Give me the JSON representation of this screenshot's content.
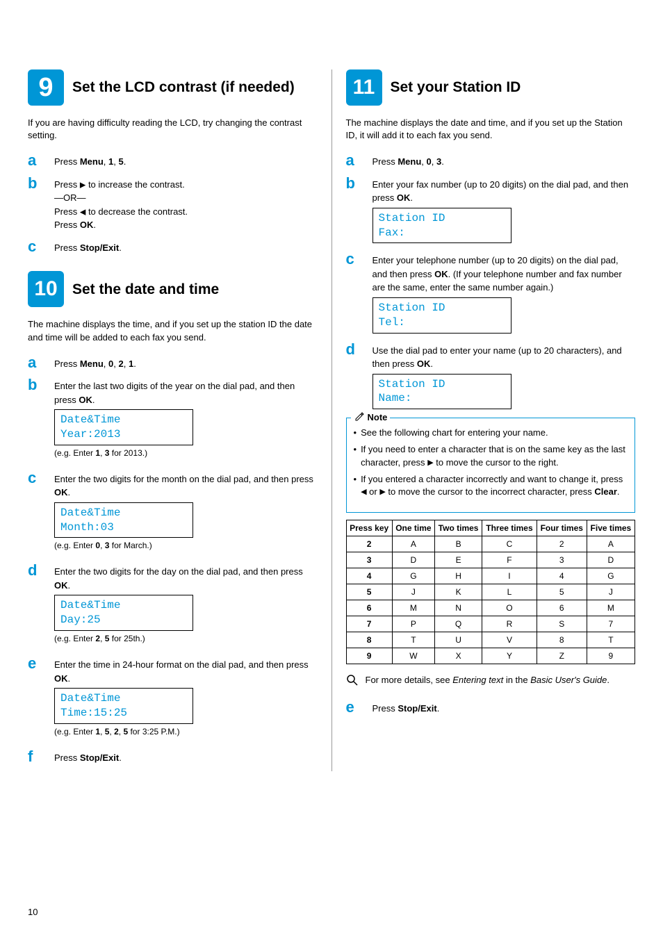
{
  "step9": {
    "num": "9",
    "title": "Set the LCD contrast (if needed)",
    "intro": "If you are having difficulty reading the LCD, try changing the contrast setting.",
    "a": {
      "pre": "Press ",
      "bold": "Menu",
      "sep1": ", ",
      "b1": "1",
      "sep2": ", ",
      "b2": "5",
      "end": "."
    },
    "b": {
      "l1": "Press",
      "l1b": " to increase the contrast.",
      "or": "—OR—",
      "l2": "Press",
      "l2b": " to decrease the contrast.",
      "l3a": "Press ",
      "l3b": "OK",
      "l3c": "."
    },
    "c": {
      "pre": "Press ",
      "bold": "Stop/Exit",
      "end": "."
    }
  },
  "step10": {
    "num": "10",
    "title": "Set the date and time",
    "intro": "The machine displays the time, and if you set up the station ID the date and time will be added to each fax you send.",
    "a": {
      "pre": "Press ",
      "bold": "Menu",
      "s1": ", ",
      "b1": "0",
      "s2": ", ",
      "b2": "2",
      "s3": ", ",
      "b3": "1",
      "end": "."
    },
    "b": {
      "txt1": "Enter the last two digits of the year on the dial pad, and then press ",
      "bold": "OK",
      "end": ".",
      "lcd1": "Date&Time",
      "lcd2": "Year:2013",
      "eg_pre": "(e.g. Enter ",
      "eg_b1": "1",
      "eg_s": ", ",
      "eg_b2": "3",
      "eg_end": " for 2013.)"
    },
    "c": {
      "txt1": "Enter the two digits for the month on the dial pad, and then press ",
      "bold": "OK",
      "end": ".",
      "lcd1": "Date&Time",
      "lcd2": "Month:03",
      "eg_pre": "(e.g. Enter ",
      "eg_b1": "0",
      "eg_s": ", ",
      "eg_b2": "3",
      "eg_end": " for March.)"
    },
    "d": {
      "txt1": "Enter the two digits for the day on the dial pad, and then press ",
      "bold": "OK",
      "end": ".",
      "lcd1": "Date&Time",
      "lcd2": "Day:25",
      "eg_pre": "(e.g. Enter ",
      "eg_b1": "2",
      "eg_s": ", ",
      "eg_b2": "5",
      "eg_end": " for 25th.)"
    },
    "e": {
      "txt1": "Enter the time in 24-hour format on the dial pad, and then press ",
      "bold": "OK",
      "end": ".",
      "lcd1": "Date&Time",
      "lcd2": "Time:15:25",
      "eg_pre": "(e.g. Enter ",
      "eg_b1": "1",
      "eg_s1": ", ",
      "eg_b2": "5",
      "eg_s2": ", ",
      "eg_b3": "2",
      "eg_s3": ", ",
      "eg_b4": "5",
      "eg_end": " for 3:25 P.M.)"
    },
    "f": {
      "pre": "Press ",
      "bold": "Stop/Exit",
      "end": "."
    }
  },
  "step11": {
    "num": "11",
    "title": "Set your Station ID",
    "intro": "The machine displays the date and time, and if you set up the Station ID, it will add it to each fax you send.",
    "a": {
      "pre": "Press ",
      "bold": "Menu",
      "s1": ", ",
      "b1": "0",
      "s2": ", ",
      "b2": "3",
      "end": "."
    },
    "b": {
      "txt1": "Enter your fax number (up to 20 digits) on the dial pad, and then press ",
      "bold": "OK",
      "end": ".",
      "lcd1": "Station ID",
      "lcd2": "Fax:"
    },
    "c": {
      "txt1": "Enter your telephone number (up to 20 digits) on the dial pad, and then press ",
      "bold": "OK",
      "end": ". (If your telephone number and fax number are the same, enter the same number again.)",
      "lcd1": "Station ID",
      "lcd2": "Tel:"
    },
    "d": {
      "txt1": "Use the dial pad to enter your name (up to 20 characters), and then press ",
      "bold": "OK",
      "end": ".",
      "lcd1": "Station ID",
      "lcd2": "Name:"
    },
    "note": {
      "title": "Note",
      "li1": "See the following chart for entering your name.",
      "li2a": "If you need to enter a character that is on the same key as the last character, press",
      "li2b": " to move the cursor to the right.",
      "li3a": "If you entered a character incorrectly and want to change it, press",
      "li3mid": " or",
      "li3b": " to move the cursor to the incorrect character, press ",
      "li3bold": "Clear",
      "li3end": "."
    },
    "table": {
      "h1": "Press key",
      "h2": "One time",
      "h3": "Two times",
      "h4": "Three times",
      "h5": "Four times",
      "h6": "Five times",
      "rows": [
        {
          "k": "2",
          "c": [
            "A",
            "B",
            "C",
            "2",
            "A"
          ]
        },
        {
          "k": "3",
          "c": [
            "D",
            "E",
            "F",
            "3",
            "D"
          ]
        },
        {
          "k": "4",
          "c": [
            "G",
            "H",
            "I",
            "4",
            "G"
          ]
        },
        {
          "k": "5",
          "c": [
            "J",
            "K",
            "L",
            "5",
            "J"
          ]
        },
        {
          "k": "6",
          "c": [
            "M",
            "N",
            "O",
            "6",
            "M"
          ]
        },
        {
          "k": "7",
          "c": [
            "P",
            "Q",
            "R",
            "S",
            "7"
          ]
        },
        {
          "k": "8",
          "c": [
            "T",
            "U",
            "V",
            "8",
            "T"
          ]
        },
        {
          "k": "9",
          "c": [
            "W",
            "X",
            "Y",
            "Z",
            "9"
          ]
        }
      ]
    },
    "hint": {
      "pre": "For more details, see ",
      "em": "Entering text",
      "mid": " in the ",
      "em2": "Basic User's Guide",
      "end": "."
    },
    "e": {
      "pre": "Press ",
      "bold": "Stop/Exit",
      "end": "."
    }
  },
  "page": "10"
}
